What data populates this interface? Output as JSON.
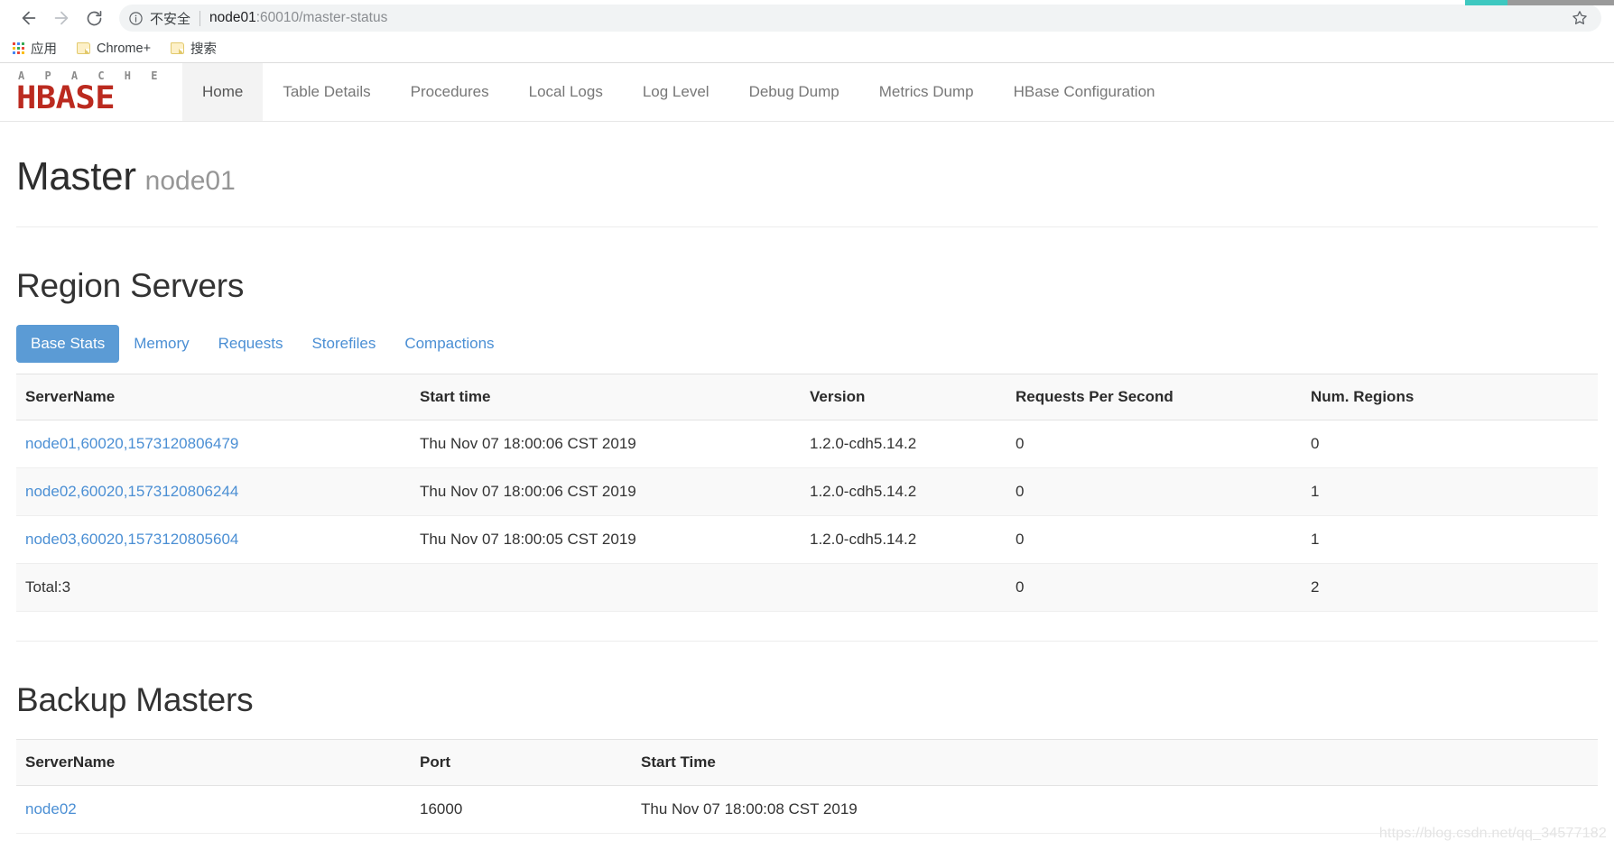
{
  "browser": {
    "back_label": "Back",
    "forward_label": "Forward",
    "reload_label": "Reload",
    "security_label": "不安全",
    "url_host": "node01",
    "url_rest": ":60010/master-status",
    "url_full": "node01:60010/master-status",
    "star_label": "Bookmark this page",
    "bookmarks": [
      {
        "label": "应用",
        "icon": "apps-grid-icon"
      },
      {
        "label": "Chrome+",
        "icon": "folder-icon"
      },
      {
        "label": "搜索",
        "icon": "folder-icon"
      }
    ]
  },
  "navbar": {
    "brand": {
      "top": "A P A C H E",
      "bottom": "HBASE"
    },
    "links": [
      {
        "label": "Home",
        "active": true
      },
      {
        "label": "Table Details",
        "active": false
      },
      {
        "label": "Procedures",
        "active": false
      },
      {
        "label": "Local Logs",
        "active": false
      },
      {
        "label": "Log Level",
        "active": false
      },
      {
        "label": "Debug Dump",
        "active": false
      },
      {
        "label": "Metrics Dump",
        "active": false
      },
      {
        "label": "HBase Configuration",
        "active": false
      }
    ]
  },
  "master": {
    "title": "Master",
    "subtitle": "node01"
  },
  "region_servers": {
    "heading": "Region Servers",
    "tabs": [
      {
        "label": "Base Stats",
        "active": true
      },
      {
        "label": "Memory",
        "active": false
      },
      {
        "label": "Requests",
        "active": false
      },
      {
        "label": "Storefiles",
        "active": false
      },
      {
        "label": "Compactions",
        "active": false
      }
    ],
    "columns": [
      "ServerName",
      "Start time",
      "Version",
      "Requests Per Second",
      "Num. Regions"
    ],
    "rows": [
      {
        "server_name": "node01,60020,1573120806479",
        "start_time": "Thu Nov 07 18:00:06 CST 2019",
        "version": "1.2.0-cdh5.14.2",
        "requests_per_second": "0",
        "num_regions": "0"
      },
      {
        "server_name": "node02,60020,1573120806244",
        "start_time": "Thu Nov 07 18:00:06 CST 2019",
        "version": "1.2.0-cdh5.14.2",
        "requests_per_second": "0",
        "num_regions": "1"
      },
      {
        "server_name": "node03,60020,1573120805604",
        "start_time": "Thu Nov 07 18:00:05 CST 2019",
        "version": "1.2.0-cdh5.14.2",
        "requests_per_second": "0",
        "num_regions": "1"
      }
    ],
    "total_row": {
      "server_name": "Total:3",
      "start_time": "",
      "version": "",
      "requests_per_second": "0",
      "num_regions": "2"
    }
  },
  "backup_masters": {
    "heading": "Backup Masters",
    "columns": [
      "ServerName",
      "Port",
      "Start Time"
    ],
    "rows": [
      {
        "server_name": "node02",
        "port": "16000",
        "start_time": "Thu Nov 07 18:00:08 CST 2019"
      }
    ]
  },
  "watermark": "https://blog.csdn.net/qq_34577182",
  "colors": {
    "accent_blue": "#5b9bd5",
    "link_blue": "#4b8fd4",
    "brand_red": "#bb2a1f",
    "header_bg": "#f9f9f9",
    "tab_teal": "#3ec8c0"
  }
}
